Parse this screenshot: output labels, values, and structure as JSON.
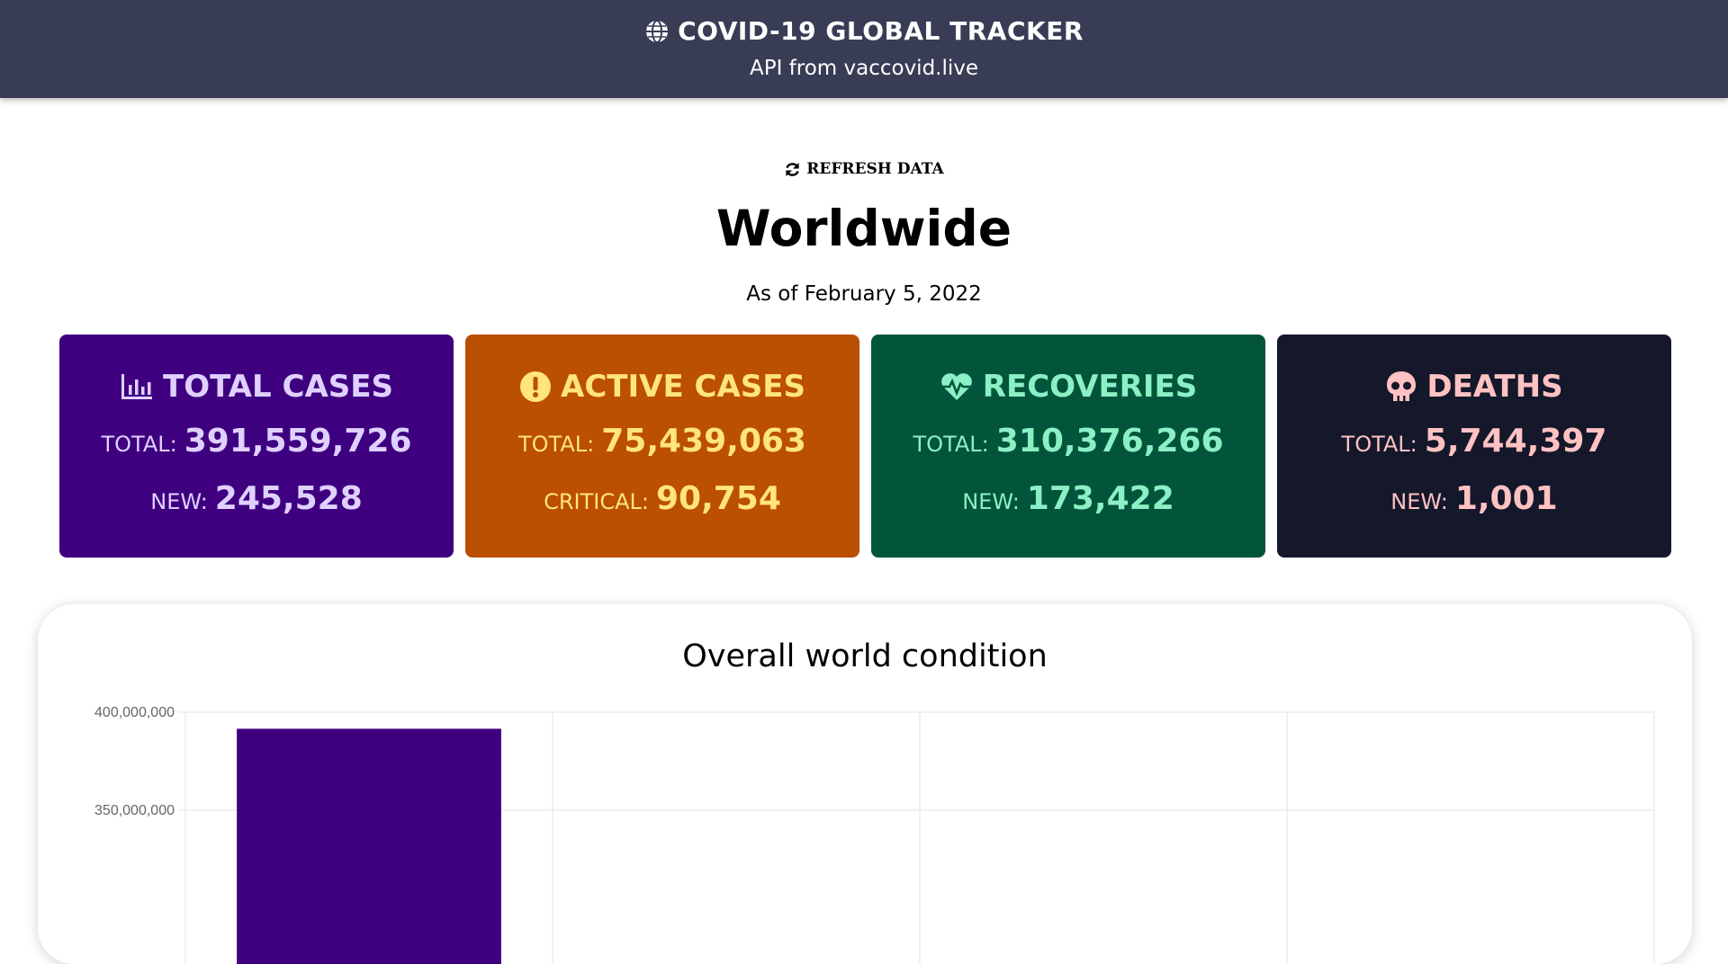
{
  "header": {
    "title": "COVID-19 GLOBAL TRACKER",
    "subtitle": "API from vaccovid.live",
    "icon": "globe-icon"
  },
  "refresh": {
    "label": "REFRESH DATA",
    "icon": "refresh-icon"
  },
  "region": {
    "title": "Worldwide",
    "as_of": "As of February 5, 2022"
  },
  "cards": {
    "total_cases": {
      "icon": "bar-chart-icon",
      "title": "TOTAL CASES",
      "row1_label": "TOTAL:",
      "row1_value": "391,559,726",
      "row2_label": "NEW:",
      "row2_value": "245,528",
      "color": "#3f0080",
      "text_color": "#dfd1ff"
    },
    "active_cases": {
      "icon": "exclamation-circle-icon",
      "title": "ACTIVE CASES",
      "row1_label": "TOTAL:",
      "row1_value": "75,439,063",
      "row2_label": "CRITICAL:",
      "row2_value": "90,754",
      "color": "#bb4f02",
      "text_color": "#ffe57a"
    },
    "recoveries": {
      "icon": "heartbeat-icon",
      "title": "RECOVERIES",
      "row1_label": "TOTAL:",
      "row1_value": "310,376,266",
      "row2_label": "NEW:",
      "row2_value": "173,422",
      "color": "#02553a",
      "text_color": "#8bf0c5"
    },
    "deaths": {
      "icon": "skull-icon",
      "title": "DEATHS",
      "row1_label": "TOTAL:",
      "row1_value": "5,744,397",
      "row2_label": "NEW:",
      "row2_value": "1,001",
      "color": "#15172b",
      "text_color": "#ffc2c2"
    }
  },
  "chart_data": {
    "type": "bar",
    "title": "Overall world condition",
    "y_tick_labels": [
      "400,000,000",
      "350,000,000"
    ],
    "y_ticks": [
      400000000,
      350000000
    ],
    "ylim_visible": [
      337500000,
      400000000
    ],
    "categories_count": 4,
    "values": [
      391559726
    ],
    "bar_color": "#3f0080",
    "grid": true
  }
}
